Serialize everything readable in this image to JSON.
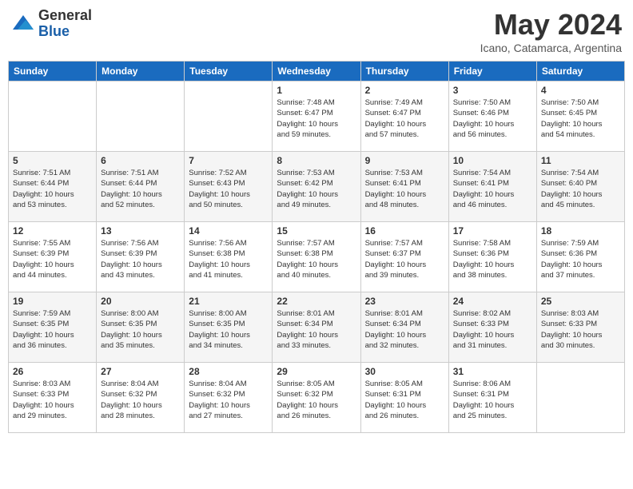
{
  "logo": {
    "general": "General",
    "blue": "Blue"
  },
  "header": {
    "month": "May 2024",
    "location": "Icano, Catamarca, Argentina"
  },
  "weekdays": [
    "Sunday",
    "Monday",
    "Tuesday",
    "Wednesday",
    "Thursday",
    "Friday",
    "Saturday"
  ],
  "weeks": [
    [
      {
        "day": "",
        "info": ""
      },
      {
        "day": "",
        "info": ""
      },
      {
        "day": "",
        "info": ""
      },
      {
        "day": "1",
        "info": "Sunrise: 7:48 AM\nSunset: 6:47 PM\nDaylight: 10 hours\nand 59 minutes."
      },
      {
        "day": "2",
        "info": "Sunrise: 7:49 AM\nSunset: 6:47 PM\nDaylight: 10 hours\nand 57 minutes."
      },
      {
        "day": "3",
        "info": "Sunrise: 7:50 AM\nSunset: 6:46 PM\nDaylight: 10 hours\nand 56 minutes."
      },
      {
        "day": "4",
        "info": "Sunrise: 7:50 AM\nSunset: 6:45 PM\nDaylight: 10 hours\nand 54 minutes."
      }
    ],
    [
      {
        "day": "5",
        "info": "Sunrise: 7:51 AM\nSunset: 6:44 PM\nDaylight: 10 hours\nand 53 minutes."
      },
      {
        "day": "6",
        "info": "Sunrise: 7:51 AM\nSunset: 6:44 PM\nDaylight: 10 hours\nand 52 minutes."
      },
      {
        "day": "7",
        "info": "Sunrise: 7:52 AM\nSunset: 6:43 PM\nDaylight: 10 hours\nand 50 minutes."
      },
      {
        "day": "8",
        "info": "Sunrise: 7:53 AM\nSunset: 6:42 PM\nDaylight: 10 hours\nand 49 minutes."
      },
      {
        "day": "9",
        "info": "Sunrise: 7:53 AM\nSunset: 6:41 PM\nDaylight: 10 hours\nand 48 minutes."
      },
      {
        "day": "10",
        "info": "Sunrise: 7:54 AM\nSunset: 6:41 PM\nDaylight: 10 hours\nand 46 minutes."
      },
      {
        "day": "11",
        "info": "Sunrise: 7:54 AM\nSunset: 6:40 PM\nDaylight: 10 hours\nand 45 minutes."
      }
    ],
    [
      {
        "day": "12",
        "info": "Sunrise: 7:55 AM\nSunset: 6:39 PM\nDaylight: 10 hours\nand 44 minutes."
      },
      {
        "day": "13",
        "info": "Sunrise: 7:56 AM\nSunset: 6:39 PM\nDaylight: 10 hours\nand 43 minutes."
      },
      {
        "day": "14",
        "info": "Sunrise: 7:56 AM\nSunset: 6:38 PM\nDaylight: 10 hours\nand 41 minutes."
      },
      {
        "day": "15",
        "info": "Sunrise: 7:57 AM\nSunset: 6:38 PM\nDaylight: 10 hours\nand 40 minutes."
      },
      {
        "day": "16",
        "info": "Sunrise: 7:57 AM\nSunset: 6:37 PM\nDaylight: 10 hours\nand 39 minutes."
      },
      {
        "day": "17",
        "info": "Sunrise: 7:58 AM\nSunset: 6:36 PM\nDaylight: 10 hours\nand 38 minutes."
      },
      {
        "day": "18",
        "info": "Sunrise: 7:59 AM\nSunset: 6:36 PM\nDaylight: 10 hours\nand 37 minutes."
      }
    ],
    [
      {
        "day": "19",
        "info": "Sunrise: 7:59 AM\nSunset: 6:35 PM\nDaylight: 10 hours\nand 36 minutes."
      },
      {
        "day": "20",
        "info": "Sunrise: 8:00 AM\nSunset: 6:35 PM\nDaylight: 10 hours\nand 35 minutes."
      },
      {
        "day": "21",
        "info": "Sunrise: 8:00 AM\nSunset: 6:35 PM\nDaylight: 10 hours\nand 34 minutes."
      },
      {
        "day": "22",
        "info": "Sunrise: 8:01 AM\nSunset: 6:34 PM\nDaylight: 10 hours\nand 33 minutes."
      },
      {
        "day": "23",
        "info": "Sunrise: 8:01 AM\nSunset: 6:34 PM\nDaylight: 10 hours\nand 32 minutes."
      },
      {
        "day": "24",
        "info": "Sunrise: 8:02 AM\nSunset: 6:33 PM\nDaylight: 10 hours\nand 31 minutes."
      },
      {
        "day": "25",
        "info": "Sunrise: 8:03 AM\nSunset: 6:33 PM\nDaylight: 10 hours\nand 30 minutes."
      }
    ],
    [
      {
        "day": "26",
        "info": "Sunrise: 8:03 AM\nSunset: 6:33 PM\nDaylight: 10 hours\nand 29 minutes."
      },
      {
        "day": "27",
        "info": "Sunrise: 8:04 AM\nSunset: 6:32 PM\nDaylight: 10 hours\nand 28 minutes."
      },
      {
        "day": "28",
        "info": "Sunrise: 8:04 AM\nSunset: 6:32 PM\nDaylight: 10 hours\nand 27 minutes."
      },
      {
        "day": "29",
        "info": "Sunrise: 8:05 AM\nSunset: 6:32 PM\nDaylight: 10 hours\nand 26 minutes."
      },
      {
        "day": "30",
        "info": "Sunrise: 8:05 AM\nSunset: 6:31 PM\nDaylight: 10 hours\nand 26 minutes."
      },
      {
        "day": "31",
        "info": "Sunrise: 8:06 AM\nSunset: 6:31 PM\nDaylight: 10 hours\nand 25 minutes."
      },
      {
        "day": "",
        "info": ""
      }
    ]
  ]
}
